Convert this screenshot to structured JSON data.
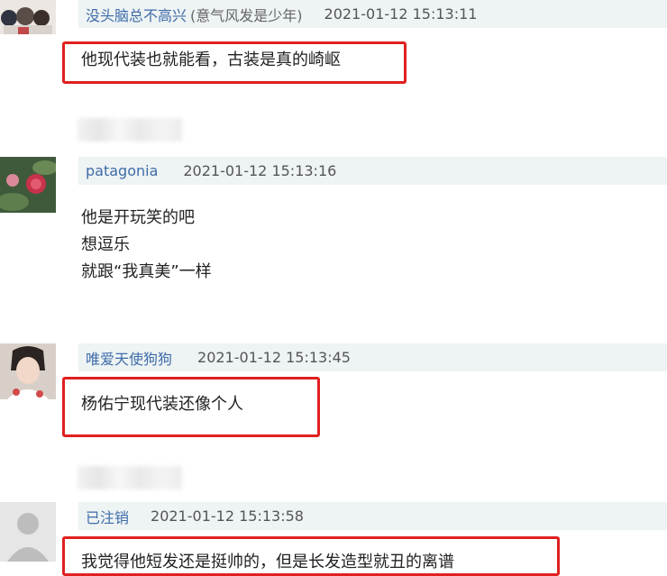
{
  "comments": [
    {
      "username": "没头脑总不高兴",
      "title": "(意气风发是少年)",
      "timestamp": "2021-01-12 15:13:11",
      "lines": [
        "他现代装也就能看，古装是真的崎岖"
      ]
    },
    {
      "username": "patagonia",
      "timestamp": "2021-01-12 15:13:16",
      "lines": [
        "他是开玩笑的吧",
        "想逗乐",
        "就跟“我真美”一样"
      ]
    },
    {
      "username": "唯爱天使狗狗",
      "timestamp": "2021-01-12 15:13:45",
      "lines": [
        "杨佑宁现代装还像个人"
      ]
    },
    {
      "username": "已注销",
      "timestamp": "2021-01-12 15:13:58",
      "lines": [
        "我觉得他短发还是挺帅的，但是长发造型就丑的离谱"
      ]
    }
  ],
  "colors": {
    "highlight": "#e02020",
    "username": "#3e6ca8",
    "meta_bg": "#eef3f4"
  },
  "icons": [
    "avatar-anime",
    "avatar-flower",
    "avatar-portrait",
    "avatar-default-silhouette"
  ]
}
